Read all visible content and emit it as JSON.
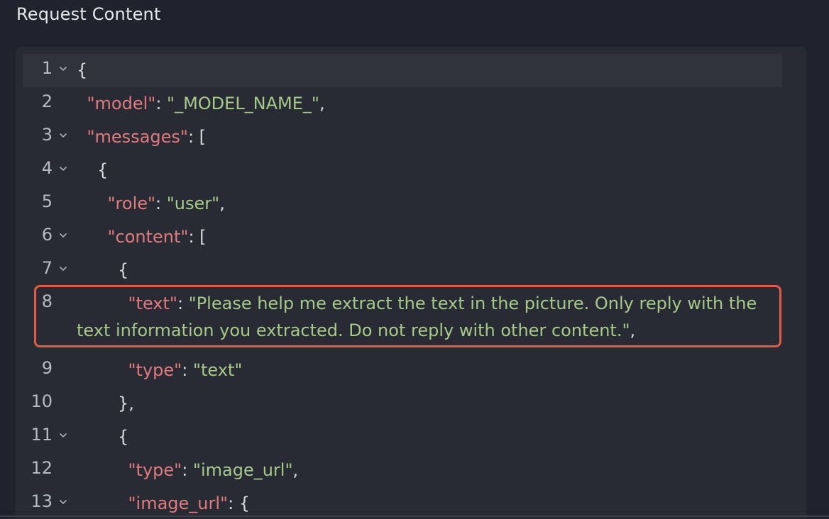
{
  "header": {
    "title": "Request Content"
  },
  "editor": {
    "lines": [
      {
        "num": "1",
        "fold": true,
        "indent": "",
        "parts": [
          {
            "t": "p",
            "v": "{"
          }
        ]
      },
      {
        "num": "2",
        "fold": false,
        "indent": " ",
        "parts": [
          {
            "t": "k",
            "v": "\"model\""
          },
          {
            "t": "p",
            "v": ": "
          },
          {
            "t": "s",
            "v": "\"_MODEL_NAME_\""
          },
          {
            "t": "p",
            "v": ","
          }
        ]
      },
      {
        "num": "3",
        "fold": true,
        "indent": " ",
        "parts": [
          {
            "t": "k",
            "v": "\"messages\""
          },
          {
            "t": "p",
            "v": ": ["
          }
        ]
      },
      {
        "num": "4",
        "fold": true,
        "indent": "  ",
        "parts": [
          {
            "t": "p",
            "v": "{"
          }
        ]
      },
      {
        "num": "5",
        "fold": false,
        "indent": "   ",
        "parts": [
          {
            "t": "k",
            "v": "\"role\""
          },
          {
            "t": "p",
            "v": ": "
          },
          {
            "t": "s",
            "v": "\"user\""
          },
          {
            "t": "p",
            "v": ","
          }
        ]
      },
      {
        "num": "6",
        "fold": true,
        "indent": "   ",
        "parts": [
          {
            "t": "k",
            "v": "\"content\""
          },
          {
            "t": "p",
            "v": ": ["
          }
        ]
      },
      {
        "num": "7",
        "fold": true,
        "indent": "    ",
        "parts": [
          {
            "t": "p",
            "v": "{"
          }
        ]
      },
      {
        "num": "8",
        "fold": false,
        "indent": "     ",
        "parts": [
          {
            "t": "k",
            "v": "\"text\""
          },
          {
            "t": "p",
            "v": ": "
          },
          {
            "t": "s",
            "v": "\"Please help me extract the text in the picture. Only reply with the"
          }
        ],
        "wrapped": [
          {
            "t": "s",
            "v": "text information you extracted. Do not reply with other content.\""
          },
          {
            "t": "p",
            "v": ","
          }
        ]
      },
      {
        "num": "9",
        "fold": false,
        "indent": "     ",
        "parts": [
          {
            "t": "k",
            "v": "\"type\""
          },
          {
            "t": "p",
            "v": ": "
          },
          {
            "t": "s",
            "v": "\"text\""
          }
        ]
      },
      {
        "num": "10",
        "fold": false,
        "indent": "    ",
        "parts": [
          {
            "t": "p",
            "v": "},"
          }
        ]
      },
      {
        "num": "11",
        "fold": true,
        "indent": "    ",
        "parts": [
          {
            "t": "p",
            "v": "{"
          }
        ]
      },
      {
        "num": "12",
        "fold": false,
        "indent": "     ",
        "parts": [
          {
            "t": "k",
            "v": "\"type\""
          },
          {
            "t": "p",
            "v": ": "
          },
          {
            "t": "s",
            "v": "\"image_url\""
          },
          {
            "t": "p",
            "v": ","
          }
        ]
      },
      {
        "num": "13",
        "fold": true,
        "indent": "     ",
        "parts": [
          {
            "t": "k",
            "v": "\"image_url\""
          },
          {
            "t": "p",
            "v": ": {"
          }
        ]
      }
    ]
  },
  "icons": {
    "fold": "chevron-down-icon"
  },
  "colors": {
    "key": "#e27a7f",
    "string": "#a8c98a",
    "punct": "#d6d9de",
    "highlight": "#e25a48"
  }
}
